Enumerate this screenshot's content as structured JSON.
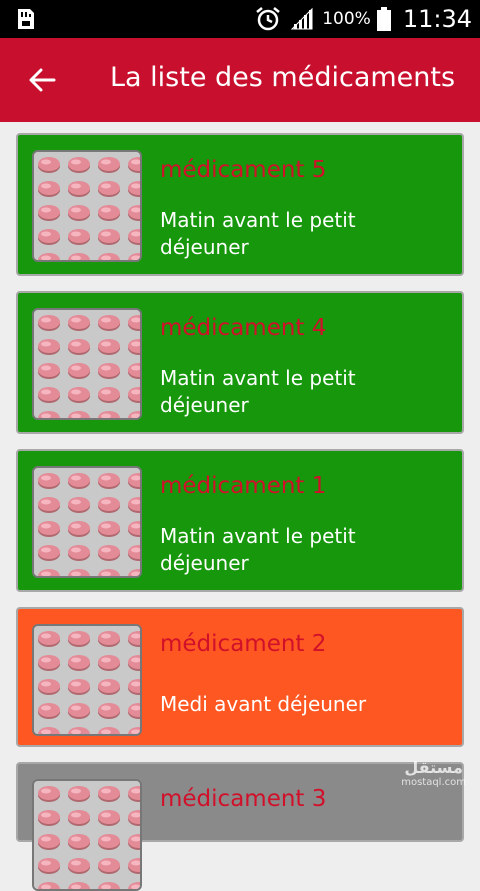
{
  "status_bar": {
    "battery_percent": "100%",
    "time": "11:34",
    "icons": [
      "sim-card-icon",
      "alarm-clock-icon",
      "signal-icon",
      "battery-icon"
    ]
  },
  "app_bar": {
    "title": "La liste des médicaments",
    "back_icon": "arrow-back-icon",
    "background_color": "#c8102e"
  },
  "medications": [
    {
      "name": "médicament 5",
      "schedule": "Matin avant le petit déjeuner",
      "status_color": "#16970c"
    },
    {
      "name": "médicament 4",
      "schedule": "Matin avant le petit déjeuner",
      "status_color": "#16970c"
    },
    {
      "name": "médicament 1",
      "schedule": "Matin avant le petit déjeuner",
      "status_color": "#16970c"
    },
    {
      "name": "médicament 2",
      "schedule": "Medi avant déjeuner",
      "status_color": "#ff5722"
    },
    {
      "name": "médicament 3",
      "schedule": "",
      "status_color": "#8a8a8a"
    }
  ],
  "watermark": {
    "logo": "مستقل",
    "domain": "mostaql.com"
  }
}
